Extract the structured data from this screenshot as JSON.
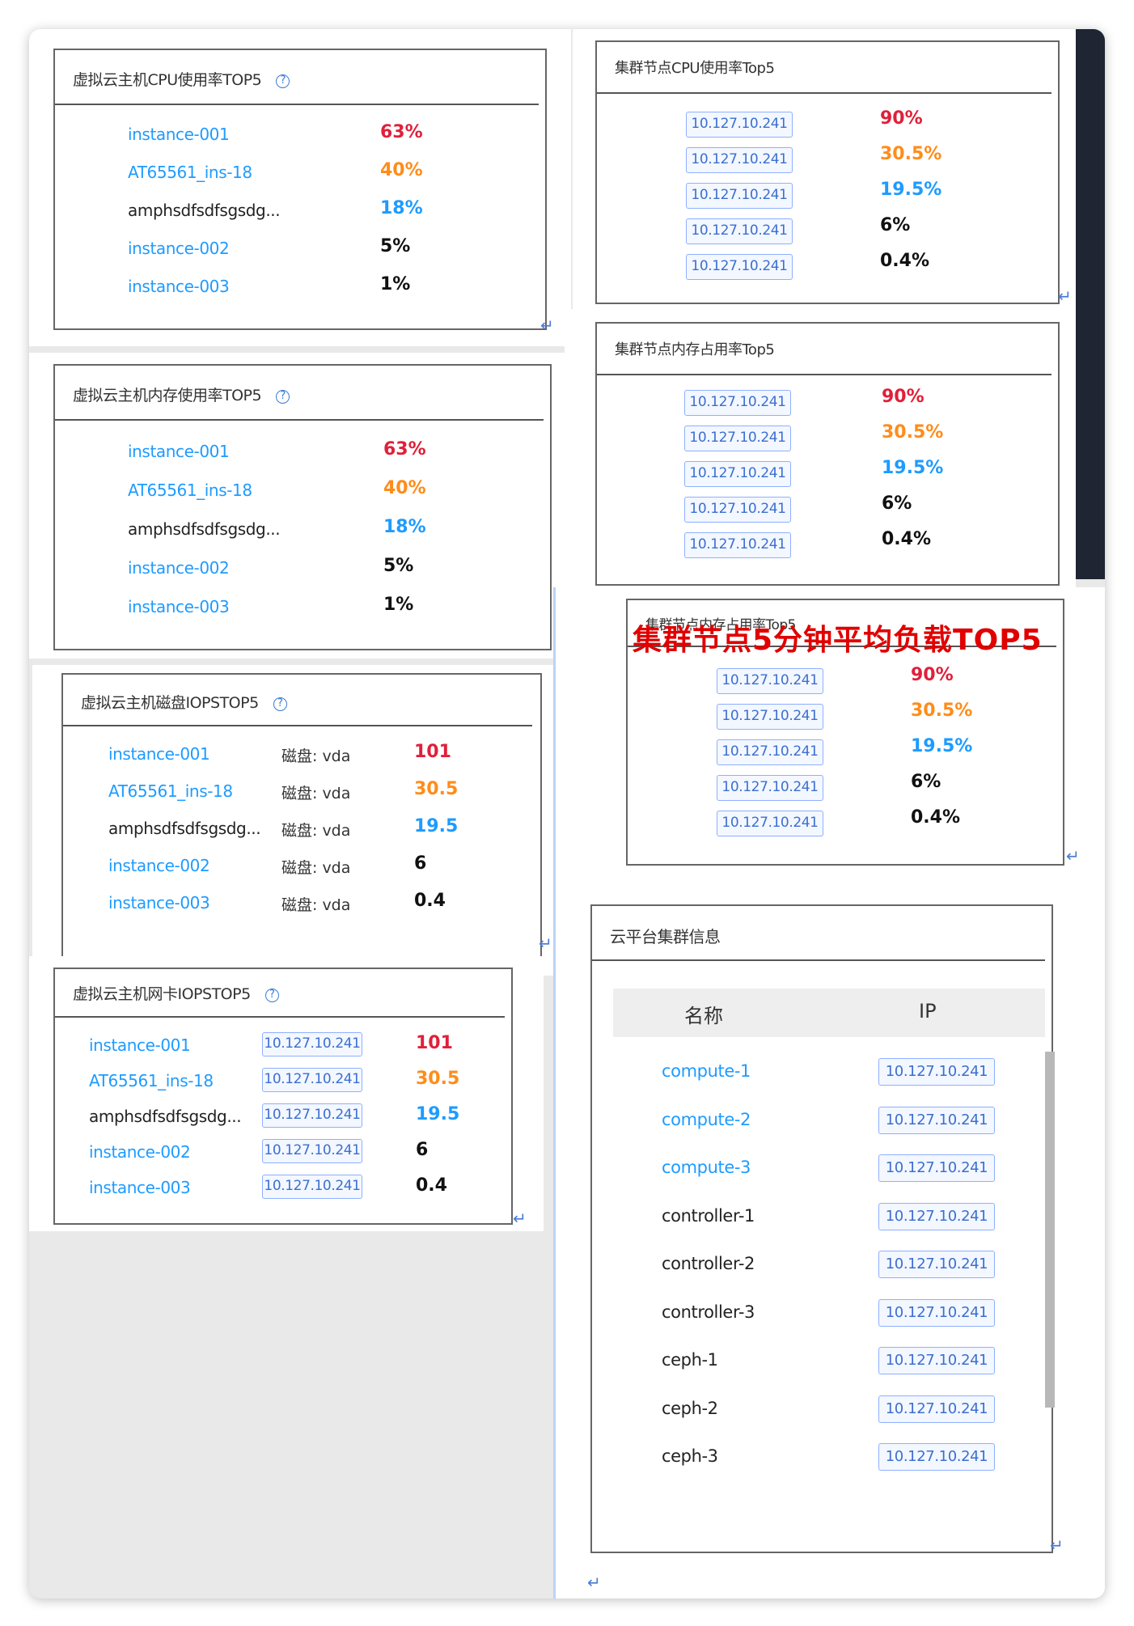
{
  "vm_cpu": {
    "title": "虚拟云主机CPU使用率TOP5",
    "rows": [
      {
        "name": "instance-001",
        "value": "63%"
      },
      {
        "name": "AT65561_ins-18",
        "value": "40%"
      },
      {
        "name": "amphsdfsdfsgsdg...",
        "value": "18%"
      },
      {
        "name": "instance-002",
        "value": "5%"
      },
      {
        "name": "instance-003",
        "value": "1%"
      }
    ]
  },
  "vm_mem": {
    "title": "虚拟云主机内存使用率TOP5",
    "rows": [
      {
        "name": "instance-001",
        "value": "63%"
      },
      {
        "name": "AT65561_ins-18",
        "value": "40%"
      },
      {
        "name": "amphsdfsdfsgsdg...",
        "value": "18%"
      },
      {
        "name": "instance-002",
        "value": "5%"
      },
      {
        "name": "instance-003",
        "value": "1%"
      }
    ]
  },
  "vm_disk": {
    "title": "虚拟云主机磁盘IOPSTOP5",
    "rows": [
      {
        "name": "instance-001",
        "disk": "磁盘: vda",
        "value": "101"
      },
      {
        "name": "AT65561_ins-18",
        "disk": "磁盘: vda",
        "value": "30.5"
      },
      {
        "name": "amphsdfsdfsgsdg...",
        "disk": "磁盘: vda",
        "value": "19.5"
      },
      {
        "name": "instance-002",
        "disk": "磁盘: vda",
        "value": "6"
      },
      {
        "name": "instance-003",
        "disk": "磁盘: vda",
        "value": "0.4"
      }
    ]
  },
  "vm_nic": {
    "title": "虚拟云主机网卡IOPSTOP5",
    "rows": [
      {
        "name": "instance-001",
        "ip": "10.127.10.241",
        "value": "101"
      },
      {
        "name": "AT65561_ins-18",
        "ip": "10.127.10.241",
        "value": "30.5"
      },
      {
        "name": "amphsdfsdfsgsdg...",
        "ip": "10.127.10.241",
        "value": "19.5"
      },
      {
        "name": "instance-002",
        "ip": "10.127.10.241",
        "value": "6"
      },
      {
        "name": "instance-003",
        "ip": "10.127.10.241",
        "value": "0.4"
      }
    ]
  },
  "node_cpu": {
    "title": "集群节点CPU使用率Top5",
    "rows": [
      {
        "ip": "10.127.10.241",
        "value": "90%"
      },
      {
        "ip": "10.127.10.241",
        "value": "30.5%"
      },
      {
        "ip": "10.127.10.241",
        "value": "19.5%"
      },
      {
        "ip": "10.127.10.241",
        "value": "6%"
      },
      {
        "ip": "10.127.10.241",
        "value": "0.4%"
      }
    ]
  },
  "node_mem": {
    "title": "集群节点内存占用率Top5",
    "rows": [
      {
        "ip": "10.127.10.241",
        "value": "90%"
      },
      {
        "ip": "10.127.10.241",
        "value": "30.5%"
      },
      {
        "ip": "10.127.10.241",
        "value": "19.5%"
      },
      {
        "ip": "10.127.10.241",
        "value": "6%"
      },
      {
        "ip": "10.127.10.241",
        "value": "0.4%"
      }
    ]
  },
  "node_load": {
    "title": "集群节点内存占用率Top5",
    "overlay_title": "集群节点5分钟平均负载TOP5",
    "rows": [
      {
        "ip": "10.127.10.241",
        "value": "90%"
      },
      {
        "ip": "10.127.10.241",
        "value": "30.5%"
      },
      {
        "ip": "10.127.10.241",
        "value": "19.5%"
      },
      {
        "ip": "10.127.10.241",
        "value": "6%"
      },
      {
        "ip": "10.127.10.241",
        "value": "0.4%"
      }
    ]
  },
  "cluster_info": {
    "title": "云平台集群信息",
    "col_name": "名称",
    "col_ip": "IP",
    "rows": [
      {
        "name": "compute-1",
        "ip": "10.127.10.241"
      },
      {
        "name": "compute-2",
        "ip": "10.127.10.241"
      },
      {
        "name": "compute-3",
        "ip": "10.127.10.241"
      },
      {
        "name": "controller-1",
        "ip": "10.127.10.241"
      },
      {
        "name": "controller-2",
        "ip": "10.127.10.241"
      },
      {
        "name": "controller-3",
        "ip": "10.127.10.241"
      },
      {
        "name": "ceph-1",
        "ip": "10.127.10.241"
      },
      {
        "name": "ceph-2",
        "ip": "10.127.10.241"
      },
      {
        "name": "ceph-3",
        "ip": "10.127.10.241"
      }
    ]
  },
  "icons": {
    "help": "?",
    "return": "↵"
  },
  "colors": {
    "red": "#e0203a",
    "orange": "#ff8c1a",
    "blue": "#1e9bff",
    "tag_border": "#8fb0ff"
  }
}
